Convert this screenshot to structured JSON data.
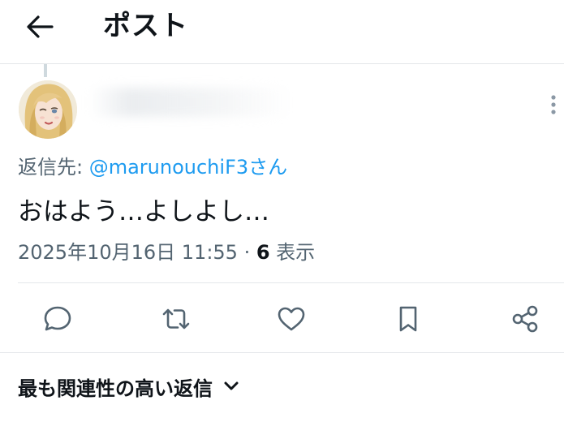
{
  "header": {
    "title": "ポスト"
  },
  "post": {
    "reply_prefix": "返信先: ",
    "reply_mention": "@marunouchiF3さん",
    "text": "おはよう…よしよし…",
    "timestamp": "2025年10月16日 11:55",
    "separator": " · ",
    "views_count": "6",
    "views_label": " 表示"
  },
  "actions": [
    "reply",
    "repost",
    "like",
    "bookmark",
    "share"
  ],
  "replies_sort": {
    "label": "最も関連性の高い返信"
  },
  "colors": {
    "accent": "#1d9bf0",
    "text_primary": "#0f1419",
    "text_secondary": "#536471",
    "divider": "#e4e7ea"
  },
  "icons": {
    "back": "arrow-left-icon",
    "more": "more-vertical-icon",
    "reply": "comment-bubble-icon",
    "repost": "repost-arrows-icon",
    "like": "heart-icon",
    "bookmark": "bookmark-icon",
    "share": "share-icon",
    "sort": "chevron-down-icon"
  }
}
